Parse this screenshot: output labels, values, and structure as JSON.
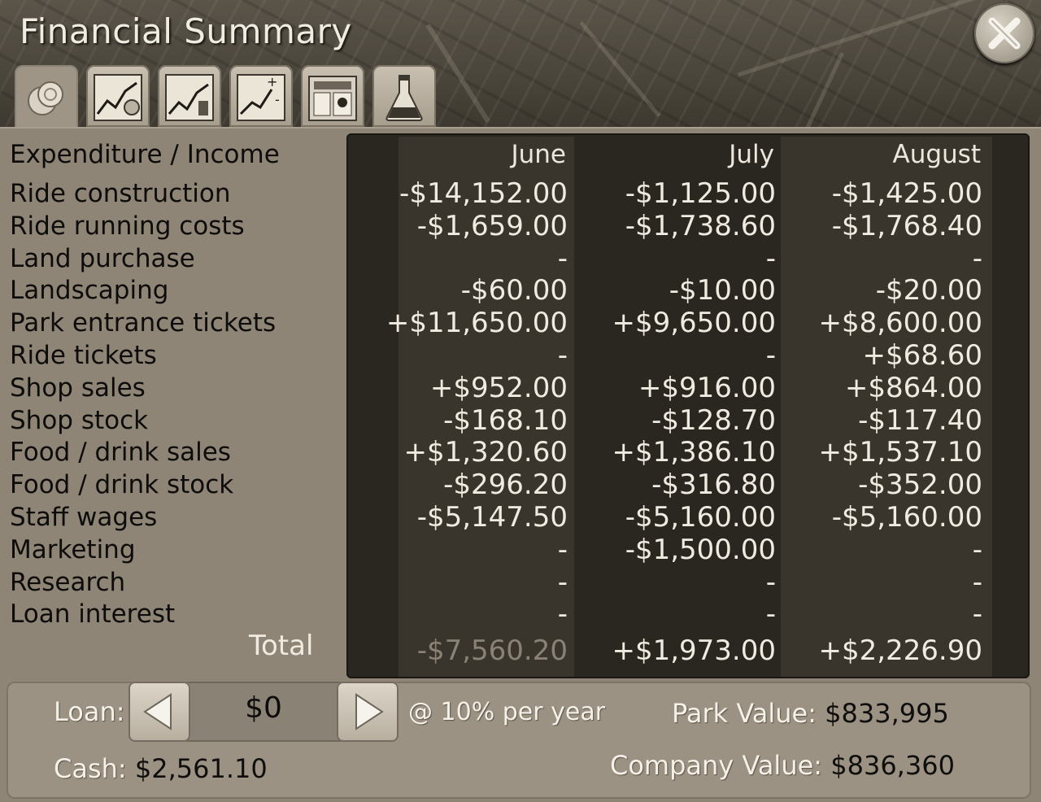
{
  "window": {
    "title": "Financial Summary"
  },
  "tabs": [
    {
      "icon": "coins-icon",
      "active": true
    },
    {
      "icon": "finance-graph-icon",
      "active": false
    },
    {
      "icon": "value-graph-icon",
      "active": false
    },
    {
      "icon": "profit-graph-icon",
      "active": false
    },
    {
      "icon": "marketing-icon",
      "active": false
    },
    {
      "icon": "research-flask-icon",
      "active": false
    }
  ],
  "table": {
    "header_label": "Expenditure / Income",
    "months": [
      "June",
      "July",
      "August"
    ],
    "rows": [
      {
        "label": "Ride construction",
        "values": [
          "-$14,152.00",
          "-$1,125.00",
          "-$1,425.00"
        ]
      },
      {
        "label": "Ride running costs",
        "values": [
          "-$1,659.00",
          "-$1,738.60",
          "-$1,768.40"
        ]
      },
      {
        "label": "Land purchase",
        "values": [
          "-",
          "-",
          "-"
        ]
      },
      {
        "label": "Landscaping",
        "values": [
          "-$60.00",
          "-$10.00",
          "-$20.00"
        ]
      },
      {
        "label": "Park entrance tickets",
        "values": [
          "+$11,650.00",
          "+$9,650.00",
          "+$8,600.00"
        ]
      },
      {
        "label": "Ride tickets",
        "values": [
          "-",
          "-",
          "+$68.60"
        ]
      },
      {
        "label": "Shop sales",
        "values": [
          "+$952.00",
          "+$916.00",
          "+$864.00"
        ]
      },
      {
        "label": "Shop stock",
        "values": [
          "-$168.10",
          "-$128.70",
          "-$117.40"
        ]
      },
      {
        "label": "Food / drink sales",
        "values": [
          "+$1,320.60",
          "+$1,386.10",
          "+$1,537.10"
        ]
      },
      {
        "label": "Food / drink stock",
        "values": [
          "-$296.20",
          "-$316.80",
          "-$352.00"
        ]
      },
      {
        "label": "Staff wages",
        "values": [
          "-$5,147.50",
          "-$5,160.00",
          "-$5,160.00"
        ]
      },
      {
        "label": "Marketing",
        "values": [
          "-",
          "-$1,500.00",
          "-"
        ]
      },
      {
        "label": "Research",
        "values": [
          "-",
          "-",
          "-"
        ]
      },
      {
        "label": "Loan interest",
        "values": [
          "-",
          "-",
          "-"
        ]
      }
    ],
    "total_label": "Total",
    "totals": [
      "-$7,560.20",
      "+$1,973.00",
      "+$2,226.90"
    ]
  },
  "footer": {
    "loan_label": "Loan:",
    "loan_value": "$0",
    "interest_text": "@ 10% per year",
    "cash_label": "Cash:",
    "cash_value": "$2,561.10",
    "park_value_label": "Park Value:",
    "park_value": "$833,995",
    "company_value_label": "Company Value:",
    "company_value": "$836,360"
  },
  "colors": {
    "negative_total": "#8a8276",
    "text_light": "#f0ebe0",
    "panel": "#8e8576"
  }
}
